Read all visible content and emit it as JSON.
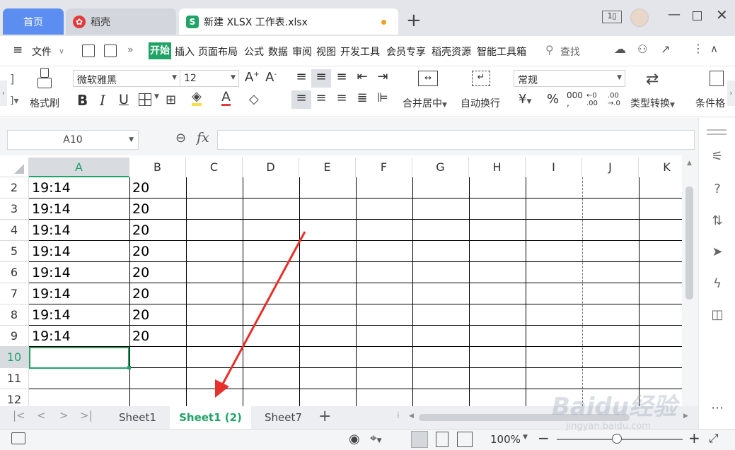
{
  "tabs": {
    "home": "首页",
    "daoke": "稻壳",
    "file": "新建 XLSX 工作表.xlsx"
  },
  "menu": {
    "file": "文件",
    "items": [
      "插入",
      "页面布局",
      "公式",
      "数据",
      "审阅",
      "视图",
      "开发工具",
      "会员专享",
      "稻壳资源",
      "智能工具箱"
    ],
    "active": "开始",
    "search": "查找"
  },
  "ribbon": {
    "format_painter": "格式刷",
    "font": "微软雅黑",
    "size": "12",
    "merge": "合并居中",
    "wrap": "自动换行",
    "number_format": "常规",
    "type_convert": "类型转换",
    "cond_format": "条件格"
  },
  "formula": {
    "cell_ref": "A10",
    "fx": "fx"
  },
  "columns": [
    "A",
    "B",
    "C",
    "D",
    "E",
    "F",
    "G",
    "H",
    "I",
    "J",
    "K"
  ],
  "rows": [
    {
      "n": "2",
      "a": "19:14",
      "b": "20"
    },
    {
      "n": "3",
      "a": "19:14",
      "b": "20"
    },
    {
      "n": "4",
      "a": "19:14",
      "b": "20"
    },
    {
      "n": "5",
      "a": "19:14",
      "b": "20"
    },
    {
      "n": "6",
      "a": "19:14",
      "b": "20"
    },
    {
      "n": "7",
      "a": "19:14",
      "b": "20"
    },
    {
      "n": "8",
      "a": "19:14",
      "b": "20"
    },
    {
      "n": "9",
      "a": "19:14",
      "b": "20"
    },
    {
      "n": "10",
      "a": "",
      "b": ""
    },
    {
      "n": "11",
      "a": "",
      "b": ""
    },
    {
      "n": "12",
      "a": "",
      "b": ""
    }
  ],
  "sheets": [
    "Sheet1",
    "Sheet1 (2)",
    "Sheet7"
  ],
  "active_sheet": "Sheet1 (2)",
  "status": {
    "zoom": "100%"
  },
  "watermark": {
    "brand": "Baidu经验",
    "url": "jingyan.baidu.com"
  },
  "colors": {
    "accent": "#21a366",
    "home_tab": "#5b8ef0",
    "arrow": "#e8302a"
  }
}
